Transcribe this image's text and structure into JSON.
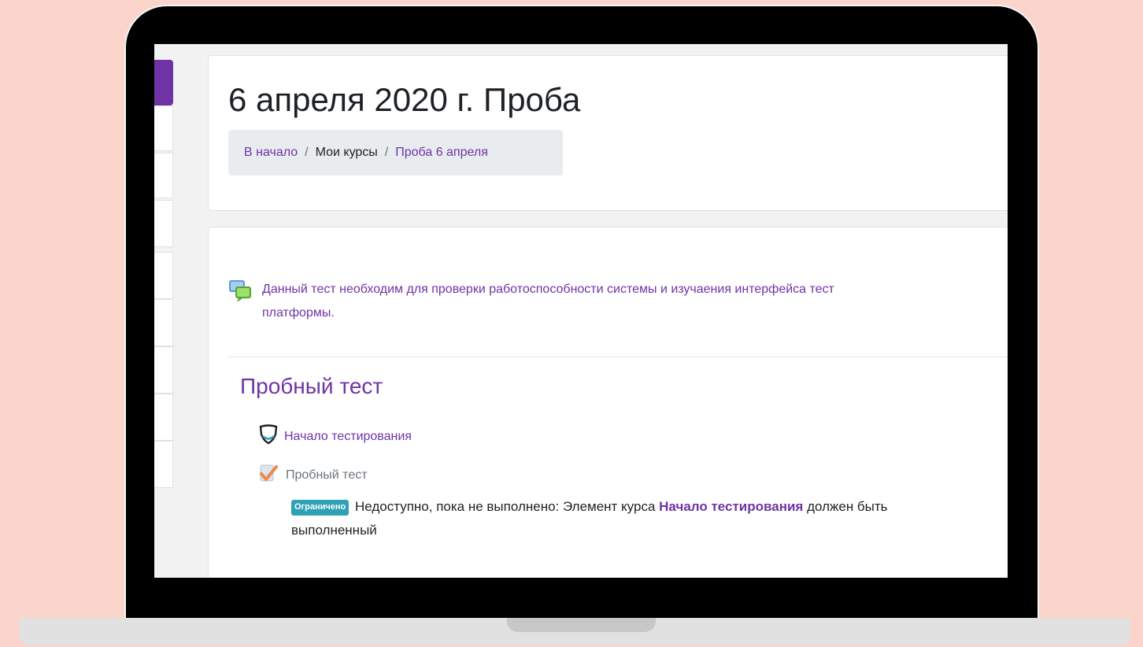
{
  "header": {
    "title": "6 апреля 2020 г. Проба",
    "breadcrumb": {
      "home": "В начало",
      "separator": "/",
      "my_courses": "Мои курсы",
      "course": "Проба 6 апреля"
    }
  },
  "course_summary": {
    "icon": "forum-chat-bubbles-icon",
    "text": "Данный тест необходим для проверки работоспособности системы и изучаения интерфейса тест",
    "text_cont": "платформы."
  },
  "section": {
    "title": "Пробный тест",
    "activities": [
      {
        "icon": "shield-icon",
        "label": "Начало тестирования",
        "state": "available"
      },
      {
        "icon": "quiz-checkmark-icon",
        "label": "Пробный тест",
        "state": "restricted"
      }
    ],
    "restriction": {
      "badge": "Ограничено",
      "text_before": "Недоступно, пока не выполнено: Элемент курса",
      "link": "Начало тестирования",
      "text_after": "должен быть",
      "text_line2": "выполненный"
    }
  },
  "colors": {
    "background": "#fbd5cc",
    "accent": "#6f33a6",
    "badge": "#2ea1b7",
    "breadcrumb_bg": "#e9ecef"
  }
}
